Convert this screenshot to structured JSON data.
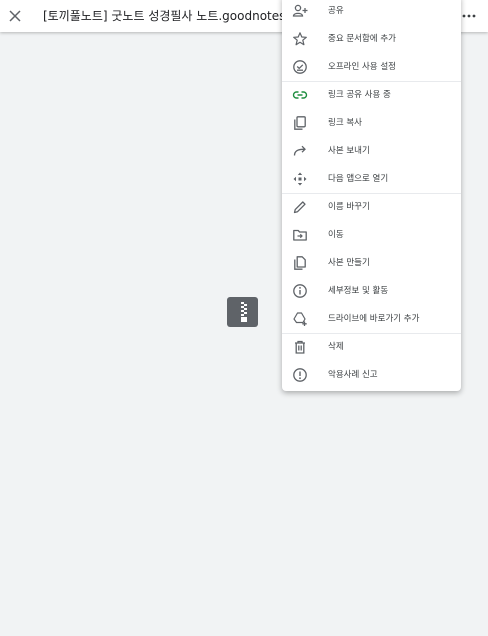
{
  "header": {
    "title": "[토끼풀노트] 굿노트 성경필사 노트.goodnotes",
    "close_icon": "close-icon",
    "more_icon": "more-horizontal-icon"
  },
  "menu": {
    "items": [
      {
        "label": "공유",
        "icon": "person-add-icon"
      },
      {
        "label": "중요 문서함에 추가",
        "icon": "star-icon"
      },
      {
        "label": "오프라인 사용 설정",
        "icon": "offline-check-icon"
      },
      {
        "label": "링크 공유 사용 중",
        "icon": "link-icon",
        "color": "#1e8e3e"
      },
      {
        "label": "링크 복사",
        "icon": "copy-icon"
      },
      {
        "label": "사본 보내기",
        "icon": "forward-arrow-icon"
      },
      {
        "label": "다음 앱으로 열기",
        "icon": "open-with-icon"
      },
      {
        "label": "이름 바꾸기",
        "icon": "pencil-icon"
      },
      {
        "label": "이동",
        "icon": "move-folder-icon"
      },
      {
        "label": "사본 만들기",
        "icon": "file-copy-icon"
      },
      {
        "label": "세부정보 및 활동",
        "icon": "info-icon"
      },
      {
        "label": "드라이브에 바로가기 추가",
        "icon": "drive-shortcut-icon"
      },
      {
        "label": "삭제",
        "icon": "trash-icon"
      },
      {
        "label": "악용사례 신고",
        "icon": "report-icon"
      }
    ]
  },
  "preview": {
    "icon": "zip-file-icon"
  }
}
